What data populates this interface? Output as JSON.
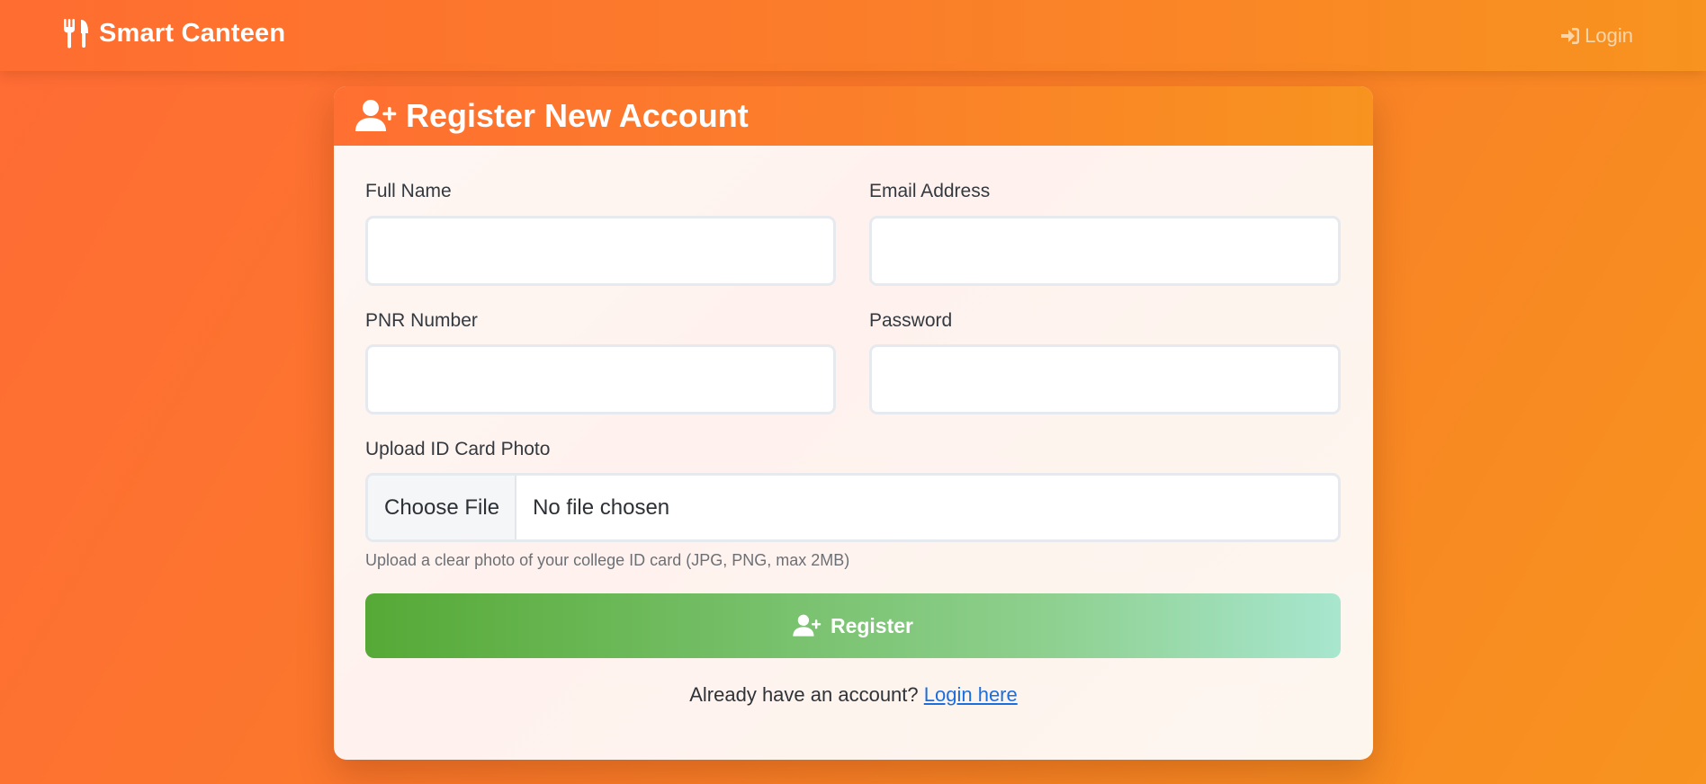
{
  "navbar": {
    "brand": "Smart Canteen",
    "brand_icon": "utensils-icon",
    "login_label": "Login",
    "login_icon": "sign-in-icon"
  },
  "card": {
    "title": "Register New Account",
    "title_icon": "user-plus-icon",
    "fields": {
      "full_name": {
        "label": "Full Name",
        "value": ""
      },
      "email": {
        "label": "Email Address",
        "value": ""
      },
      "pnr": {
        "label": "PNR Number",
        "value": ""
      },
      "password": {
        "label": "Password",
        "value": ""
      }
    },
    "upload": {
      "label": "Upload ID Card Photo",
      "button_label": "Choose File",
      "status": "No file chosen",
      "help": "Upload a clear photo of your college ID card (JPG, PNG, max 2MB)"
    },
    "register_button": "Register",
    "register_icon": "user-plus-icon",
    "footer": {
      "prompt": "Already have an account?",
      "link": "Login here"
    }
  },
  "colors": {
    "primary": "#ff6b35",
    "secondary": "#f7931e",
    "success_start": "#56ab2f",
    "success_end": "#a8e6cf",
    "link": "#1a6fe0"
  }
}
